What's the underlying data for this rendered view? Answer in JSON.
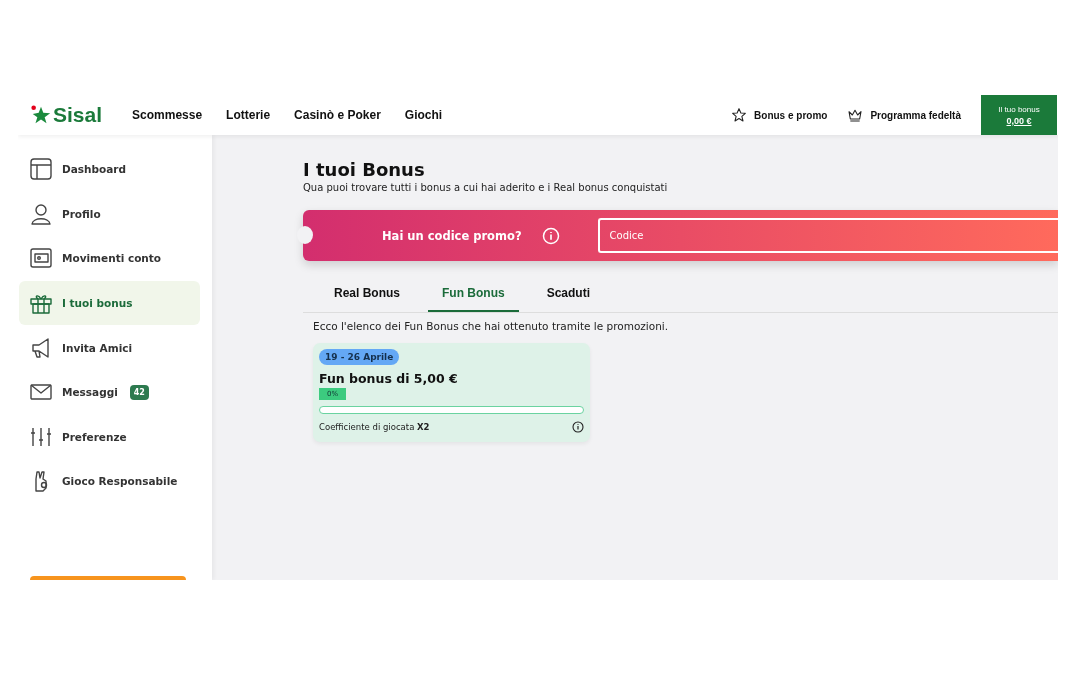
{
  "header": {
    "logo": "Sisal",
    "nav": [
      "Scommesse",
      "Lotterie",
      "Casinò e Poker",
      "Giochi"
    ],
    "links": [
      {
        "kind": "star",
        "label": "Bonus e promo"
      },
      {
        "kind": "crown",
        "label": "Programma fedeltà"
      }
    ],
    "bonus_box": {
      "label": "Il tuo bonus",
      "amount": "0,00 €"
    }
  },
  "sidebar": {
    "items": [
      {
        "kind": "dashboard",
        "label": "Dashboard",
        "selected": false
      },
      {
        "kind": "user",
        "label": "Profilo",
        "selected": false
      },
      {
        "kind": "wallet",
        "label": "Movimenti conto",
        "selected": false
      },
      {
        "kind": "gift",
        "label": "I tuoi bonus",
        "selected": true
      },
      {
        "kind": "megaphone",
        "label": "Invita Amici",
        "selected": false
      },
      {
        "kind": "mail",
        "label": "Messaggi",
        "selected": false,
        "badge": "42"
      },
      {
        "kind": "sliders",
        "label": "Preferenze",
        "selected": false
      },
      {
        "kind": "hand",
        "label": "Gioco Responsabile",
        "selected": false
      }
    ]
  },
  "page": {
    "title": "I tuoi Bonus",
    "subtitle": "Qua puoi trovare tutti i bonus a cui hai aderito e i Real bonus conquistati",
    "promo": {
      "label": "Hai un codice promo?",
      "placeholder": "Codice"
    },
    "tabs": [
      {
        "label": "Real Bonus",
        "selected": false
      },
      {
        "label": "Fun Bonus",
        "selected": true
      },
      {
        "label": "Scaduti",
        "selected": false
      }
    ],
    "description": "Ecco l'elenco dei Fun Bonus che hai ottenuto tramite le promozioni.",
    "cards": [
      {
        "date": "19 - 26 Aprile",
        "title": "Fun bonus di 5,00 €",
        "percent": "0%",
        "level": 0,
        "coefficient": "Coefficiente di giocata **X2**"
      }
    ]
  }
}
